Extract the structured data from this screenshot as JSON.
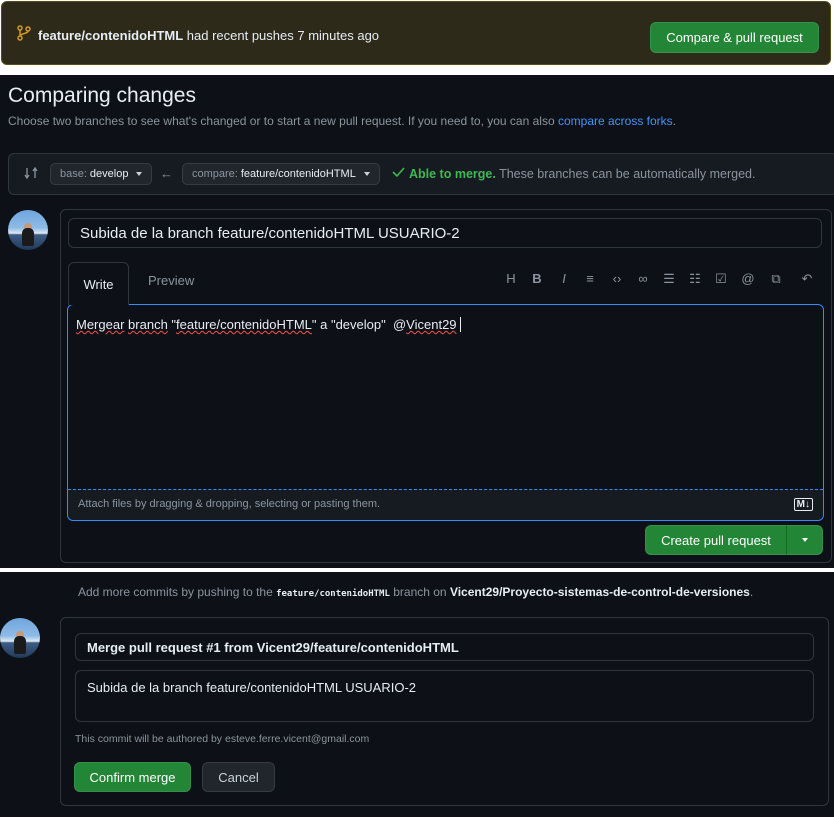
{
  "banner": {
    "branch": "feature/contenidoHTML",
    "message": " had recent pushes 7 minutes ago",
    "button": "Compare & pull request"
  },
  "compare": {
    "title": "Comparing changes",
    "subtitle": "Choose two branches to see what's changed or to start a new pull request. If you need to, you can also ",
    "subtitle_link": "compare across forks",
    "subtitle_end": ".",
    "base_label": "base:",
    "base_value": "develop",
    "compare_label": "compare:",
    "compare_value": "feature/contenidoHTML",
    "merge_status": "Able to merge.",
    "merge_detail": " These branches can be automatically merged."
  },
  "pr_form": {
    "title_value": "Subida de la branch feature/contenidoHTML USUARIO-2",
    "tab_write": "Write",
    "tab_preview": "Preview",
    "toolbar": [
      "H",
      "B",
      "I",
      "heading-list",
      "code",
      "link",
      "bullet-list",
      "numbered-list",
      "task-list",
      "mention",
      "reference",
      "reply"
    ],
    "body_parts": [
      "Mergear",
      " ",
      "branch",
      " \"",
      "feature/contenidoHTML",
      "\" a \"",
      "develop",
      "\"  @",
      "Vicent29"
    ],
    "attach_hint": "Attach files by dragging & dropping, selecting or pasting them.",
    "create_button": "Create pull request"
  },
  "merge": {
    "info_prefix": "Add more commits by pushing to the ",
    "info_branch": "feature/contenidoHTML",
    "info_mid": " branch on ",
    "info_repo": "Vicent29/Proyecto-sistemas-de-control-de-versiones",
    "info_end": ".",
    "commit_title": "Merge pull request #1 from Vicent29/feature/contenidoHTML",
    "commit_body": "Subida de la branch feature/contenidoHTML USUARIO-2",
    "author_note": "This commit will be authored by esteve.ferre.vicent@gmail.com",
    "confirm_button": "Confirm merge",
    "cancel_button": "Cancel"
  },
  "colors": {
    "accent_green": "#238636",
    "link_blue": "#4493f8",
    "merge_green": "#3fb950",
    "banner_bg": "#2d2a1a"
  }
}
